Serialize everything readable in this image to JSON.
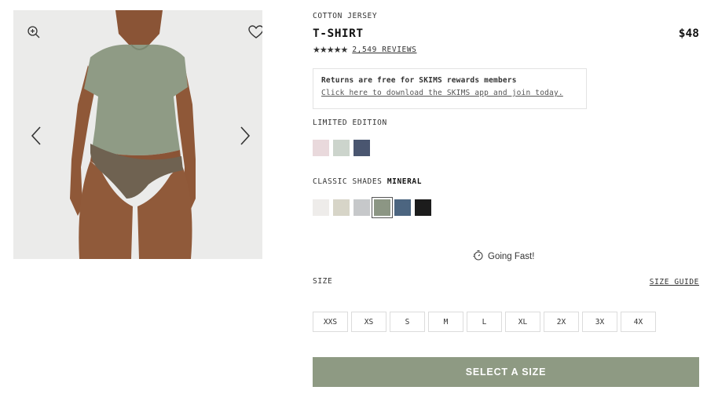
{
  "gallery": {
    "zoom_icon": "zoom-in-icon",
    "favorite_icon": "heart-icon",
    "prev_icon": "chevron-left-icon",
    "next_icon": "chevron-right-icon"
  },
  "product": {
    "category": "COTTON JERSEY",
    "name": "T-SHIRT",
    "price": "$48",
    "rating_stars": "★★★★★",
    "rating_value": 5,
    "reviews_label": "2,549 REVIEWS"
  },
  "promo": {
    "title": "Returns are free for SKIMS rewards members",
    "link": "Click here to download the SKIMS app and join today."
  },
  "limited_edition": {
    "label": "LIMITED EDITION",
    "swatches": [
      "#e9d9dc",
      "#ccd4cc",
      "#4a5670"
    ]
  },
  "classic_shades": {
    "label": "CLASSIC SHADES",
    "selected_name": "MINERAL",
    "swatches": [
      "#eeecea",
      "#d7d5c8",
      "#c6c8ca",
      "#8c9684",
      "#4c6580",
      "#1c1c1c"
    ],
    "selected_index": 3
  },
  "stock": {
    "icon": "stopwatch-icon",
    "text": "Going Fast!"
  },
  "size": {
    "label": "SIZE",
    "guide_label": "SIZE GUIDE",
    "options": [
      "XXS",
      "XS",
      "S",
      "M",
      "L",
      "XL",
      "2X",
      "3X",
      "4X"
    ]
  },
  "cta": {
    "label": "SELECT A SIZE",
    "color": "#8e9a83"
  }
}
